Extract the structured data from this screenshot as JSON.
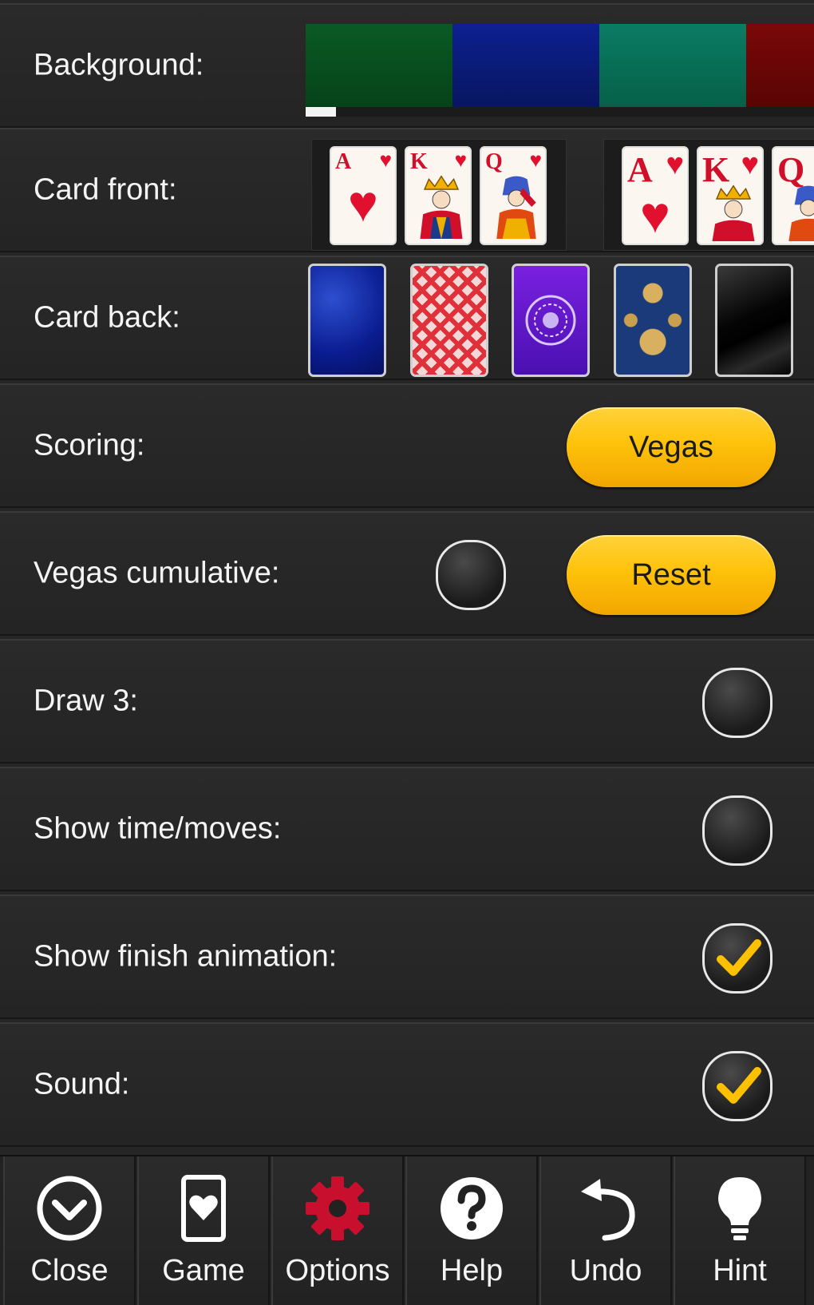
{
  "settings": {
    "background_label": "Background:",
    "card_front_label": "Card front:",
    "card_back_label": "Card back:",
    "scoring_label": "Scoring:",
    "scoring_value": "Vegas",
    "vegas_cumulative_label": "Vegas cumulative:",
    "vegas_cumulative_checked": false,
    "reset_label": "Reset",
    "draw3_label": "Draw 3:",
    "draw3_checked": false,
    "show_time_label": "Show time/moves:",
    "show_time_checked": false,
    "finish_animation_label": "Show finish animation:",
    "finish_animation_checked": true,
    "sound_label": "Sound:",
    "sound_checked": true
  },
  "background_colors": [
    "#07501f",
    "#0a1a78",
    "#08705a",
    "#6a0505"
  ],
  "card_front_sets": [
    {
      "cards": [
        {
          "rank": "A"
        },
        {
          "rank": "K"
        },
        {
          "rank": "Q"
        }
      ]
    },
    {
      "cards": [
        {
          "rank": "A"
        },
        {
          "rank": "K"
        },
        {
          "rank": "Q"
        }
      ]
    }
  ],
  "card_backs": [
    "blue-texture",
    "red-pattern",
    "purple-mandala",
    "blue-gold-damask",
    "black-glossy"
  ],
  "colors": {
    "accent_yellow": "#ffc20a",
    "options_red": "#c8102e",
    "check_yellow": "#ffc000"
  },
  "toolbar": {
    "items": [
      {
        "label": "Close",
        "icon": "chevron-down-circle-icon"
      },
      {
        "label": "Game",
        "icon": "card-icon"
      },
      {
        "label": "Options",
        "icon": "gear-icon"
      },
      {
        "label": "Help",
        "icon": "help-icon"
      },
      {
        "label": "Undo",
        "icon": "undo-icon"
      },
      {
        "label": "Hint",
        "icon": "lightbulb-icon"
      }
    ]
  }
}
